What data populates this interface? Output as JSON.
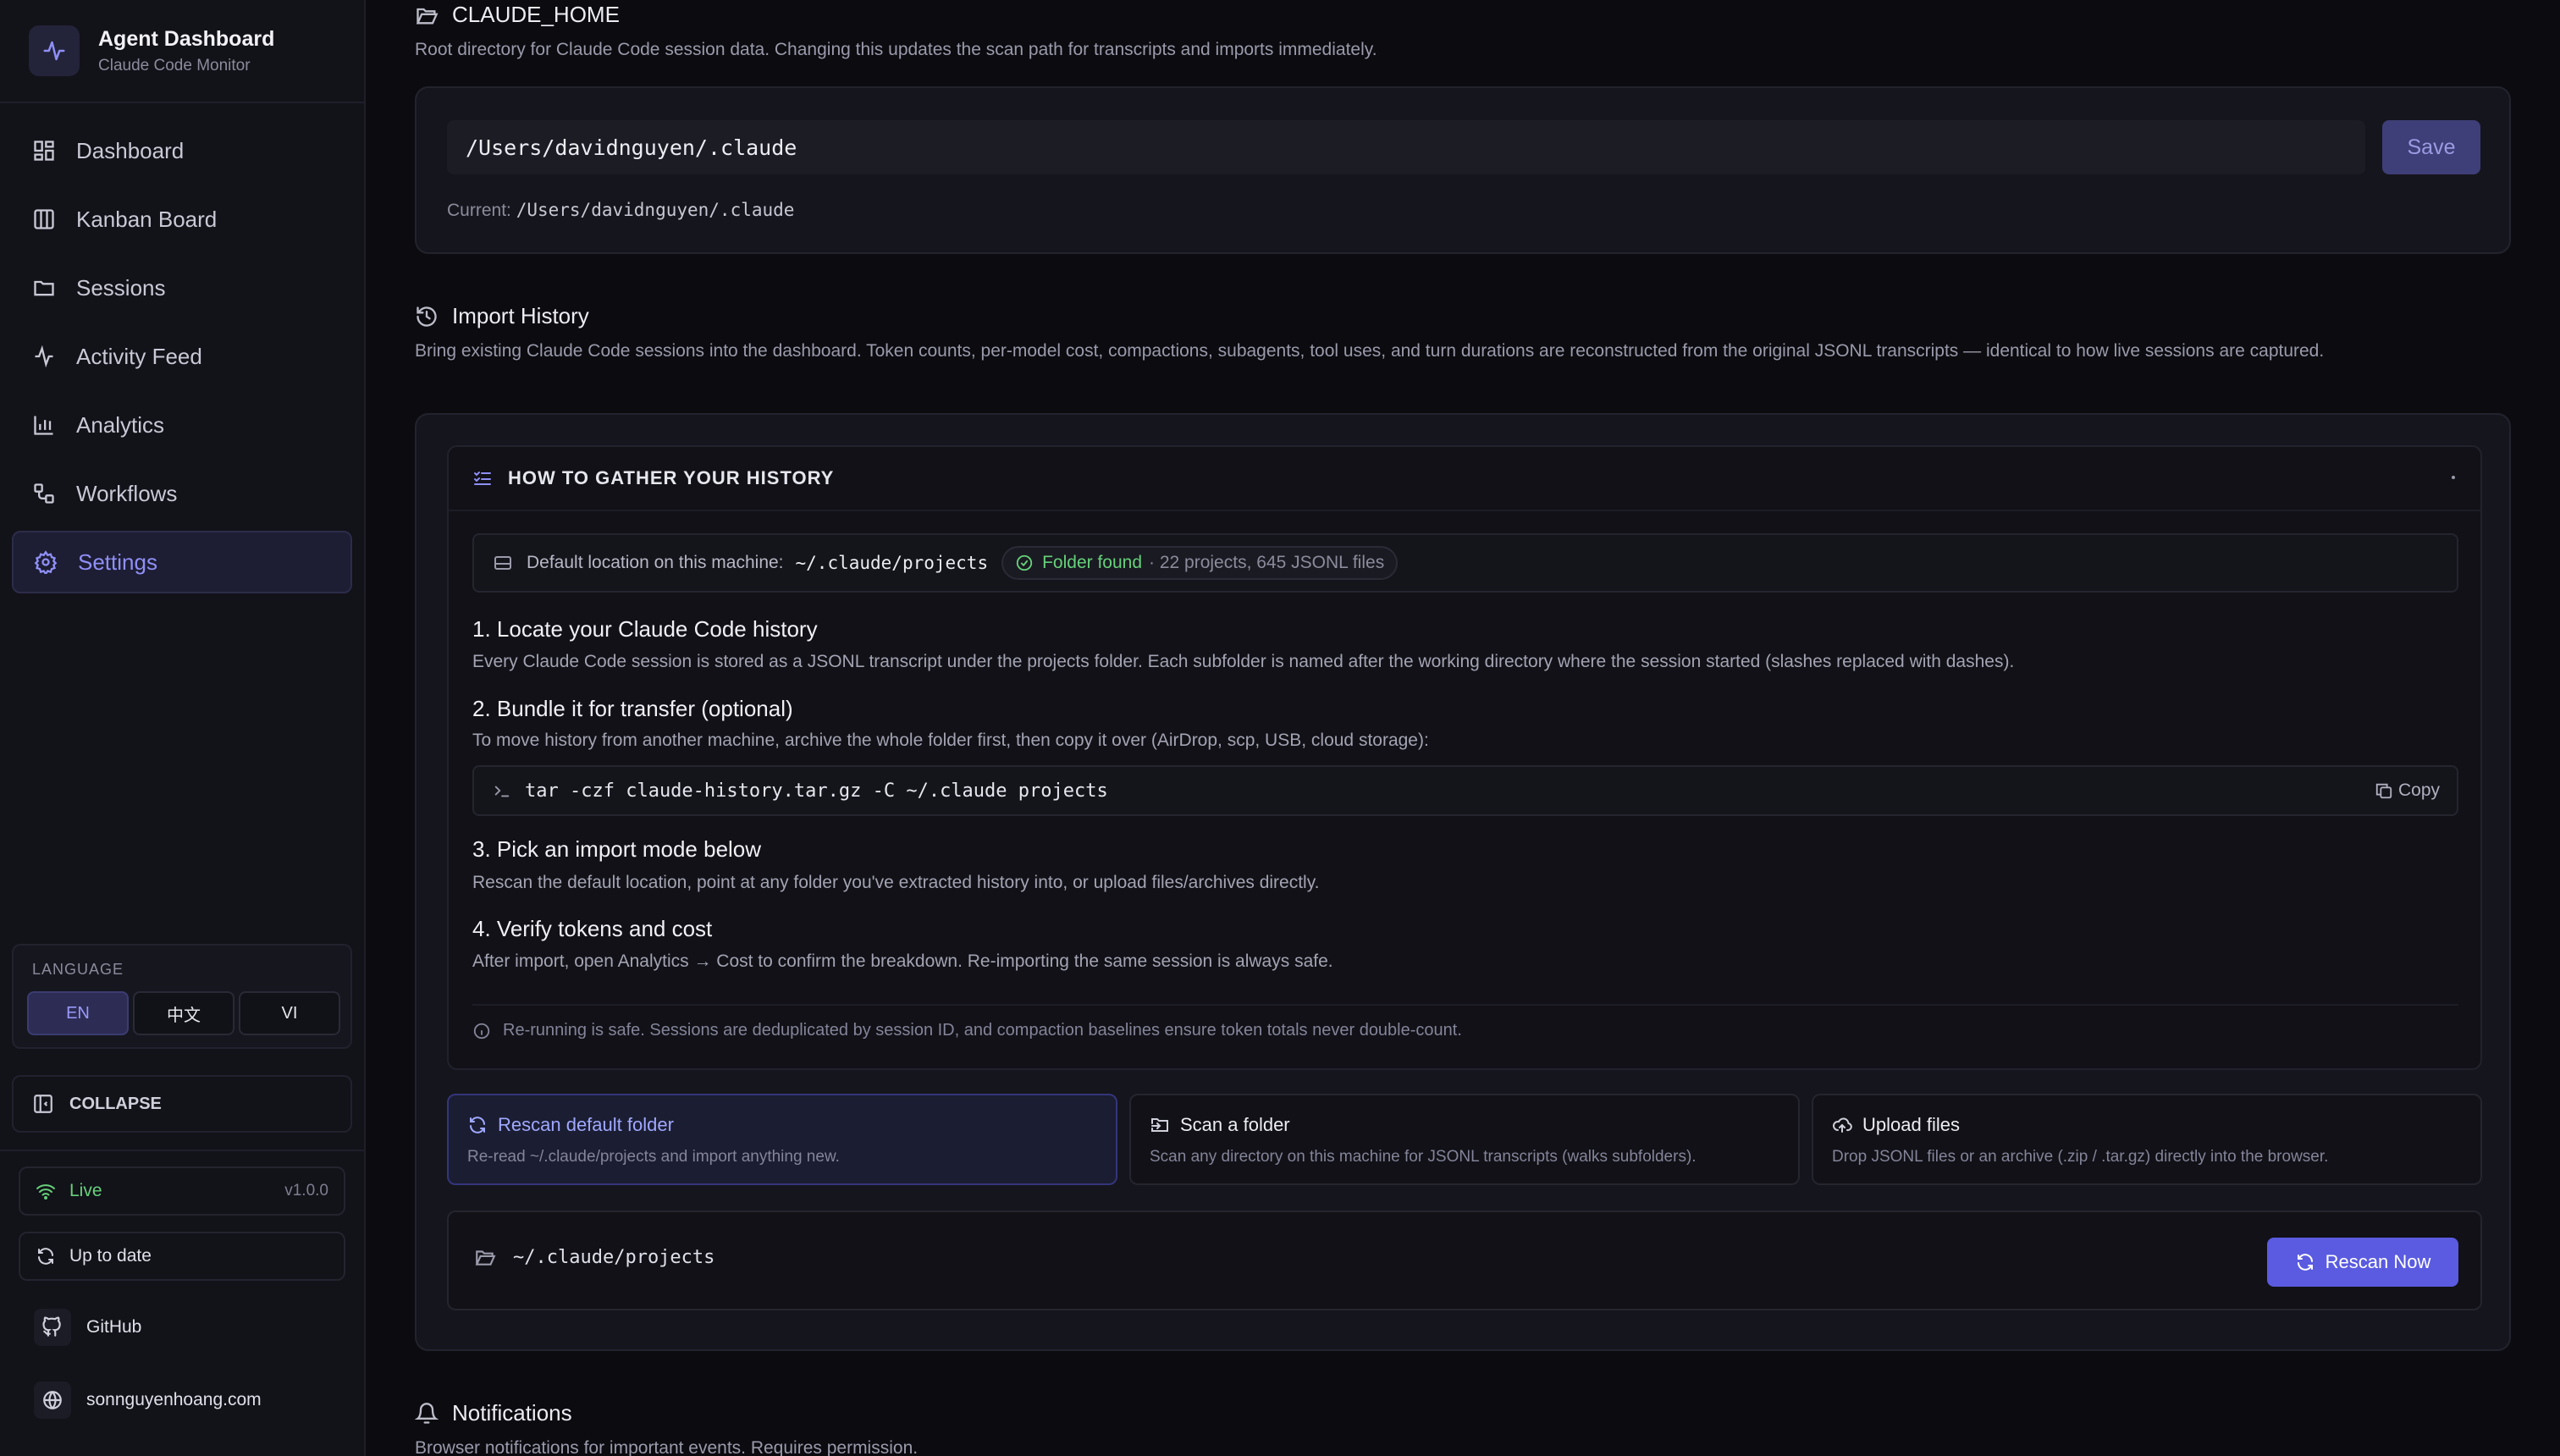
{
  "sidebar": {
    "brand_title": "Agent Dashboard",
    "brand_subtitle": "Claude Code Monitor",
    "nav": [
      {
        "label": "Dashboard",
        "icon": "grid-icon"
      },
      {
        "label": "Kanban Board",
        "icon": "columns-icon"
      },
      {
        "label": "Sessions",
        "icon": "folder-icon"
      },
      {
        "label": "Activity Feed",
        "icon": "activity-icon"
      },
      {
        "label": "Analytics",
        "icon": "bar-chart-icon"
      },
      {
        "label": "Workflows",
        "icon": "workflow-icon"
      },
      {
        "label": "Settings",
        "icon": "gear-icon",
        "active": true
      }
    ],
    "language": {
      "title": "LANGUAGE",
      "options": [
        "EN",
        "中文",
        "VI"
      ],
      "selected": "EN"
    },
    "collapse_label": "COLLAPSE",
    "status": {
      "live_label": "Live",
      "version": "v1.0.0",
      "update_label": "Up to date"
    },
    "links": [
      {
        "label": "GitHub",
        "icon": "github-icon"
      },
      {
        "label": "sonnguyenhoang.com",
        "icon": "globe-icon"
      }
    ]
  },
  "claude_home": {
    "title": "CLAUDE_HOME",
    "description": "Root directory for Claude Code session data. Changing this updates the scan path for transcripts and imports immediately.",
    "input_value": "/Users/davidnguyen/.claude",
    "save_label": "Save",
    "current_label": "Current:",
    "current_value": "/Users/davidnguyen/.claude"
  },
  "import_history": {
    "title": "Import History",
    "description": "Bring existing Claude Code sessions into the dashboard. Token counts, per-model cost, compactions, subagents, tool uses, and turn durations are reconstructed from the original JSONL transcripts — identical to how live sessions are captured.",
    "howto": {
      "title": "HOW TO GATHER YOUR HISTORY",
      "default_location_label": "Default location on this machine:",
      "default_location_path": "~/.claude/projects",
      "found_label": "Folder found",
      "found_counts": "· 22 projects, 645 JSONL files",
      "steps": [
        {
          "title": "1. Locate your Claude Code history",
          "text": "Every Claude Code session is stored as a JSONL transcript under the projects folder. Each subfolder is named after the working directory where the session started (slashes replaced with dashes)."
        },
        {
          "title": "2. Bundle it for transfer (optional)",
          "text": "To move history from another machine, archive the whole folder first, then copy it over (AirDrop, scp, USB, cloud storage):"
        },
        {
          "title": "3. Pick an import mode below",
          "text": "Rescan the default location, point at any folder you've extracted history into, or upload files/archives directly."
        },
        {
          "title": "4. Verify tokens and cost",
          "text": "After import, open Analytics → Cost to confirm the breakdown. Re-importing the same session is always safe."
        }
      ],
      "command": "tar -czf claude-history.tar.gz -C ~/.claude projects",
      "copy_label": "Copy",
      "note": "Re-running is safe. Sessions are deduplicated by session ID, and compaction baselines ensure token totals never double-count."
    },
    "modes": [
      {
        "title": "Rescan default folder",
        "desc": "Re-read ~/.claude/projects and import anything new.",
        "icon": "refresh-icon",
        "active": true
      },
      {
        "title": "Scan a folder",
        "desc": "Scan any directory on this machine for JSONL transcripts (walks subfolders).",
        "icon": "folder-input-icon"
      },
      {
        "title": "Upload files",
        "desc": "Drop JSONL files or an archive (.zip / .tar.gz) directly into the browser.",
        "icon": "cloud-upload-icon"
      }
    ],
    "rescan_path": "~/.claude/projects",
    "rescan_button": "Rescan Now"
  },
  "notifications": {
    "title": "Notifications",
    "description": "Browser notifications for important events. Requires permission."
  },
  "colors": {
    "accent": "#5a5be0",
    "accent_text": "#8f8ff7",
    "success": "#66d17a",
    "background": "#0b0b10"
  }
}
